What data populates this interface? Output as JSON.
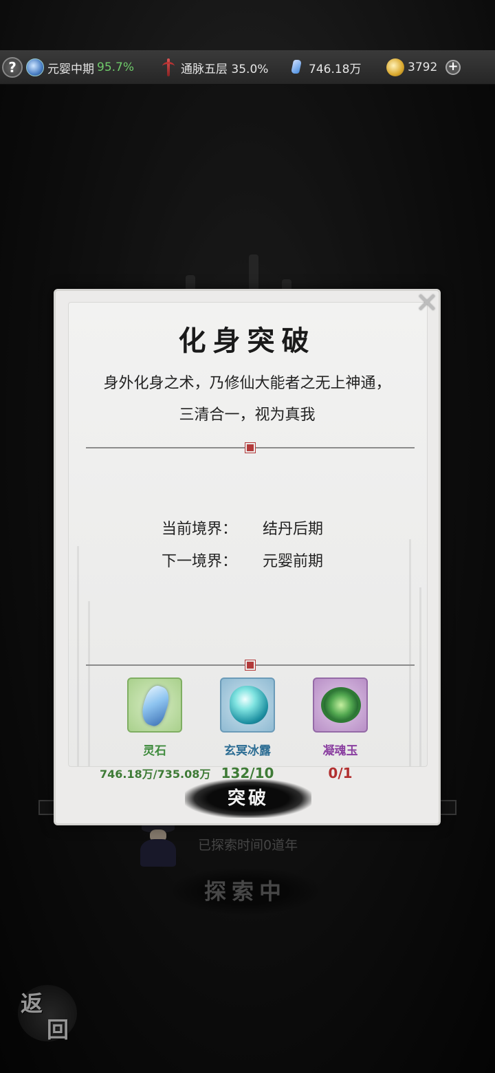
{
  "topbar": {
    "help_label": "?",
    "realm_name": "元婴中期",
    "realm_progress": "95.7%",
    "meridian": "通脉五层 35.0%",
    "spirit_stone": "746.18万",
    "gold": "3792",
    "plus_label": "+"
  },
  "background": {
    "explore_time": "已探索时间0道年",
    "exploring_button": "探索中",
    "back_button_char1": "返",
    "back_button_char2": "回"
  },
  "dialog": {
    "close_label": "✕",
    "title": "化身突破",
    "desc_line1": "身外化身之术，乃修仙大能者之无上神通，",
    "desc_line2": "三清合一，视为真我",
    "current_realm_label": "当前境界：",
    "current_realm_value": "结丹后期",
    "next_realm_label": "下一境界：",
    "next_realm_value": "元婴前期",
    "items": [
      {
        "name": "灵石",
        "count": "746.18万/735.08万",
        "icon": "spirit-stone-icon"
      },
      {
        "name": "玄冥冰露",
        "count": "132/10",
        "icon": "ice-dew-icon"
      },
      {
        "name": "凝魂玉",
        "count": "0/1",
        "icon": "soul-jade-icon"
      }
    ],
    "breakthrough_button": "突破"
  }
}
